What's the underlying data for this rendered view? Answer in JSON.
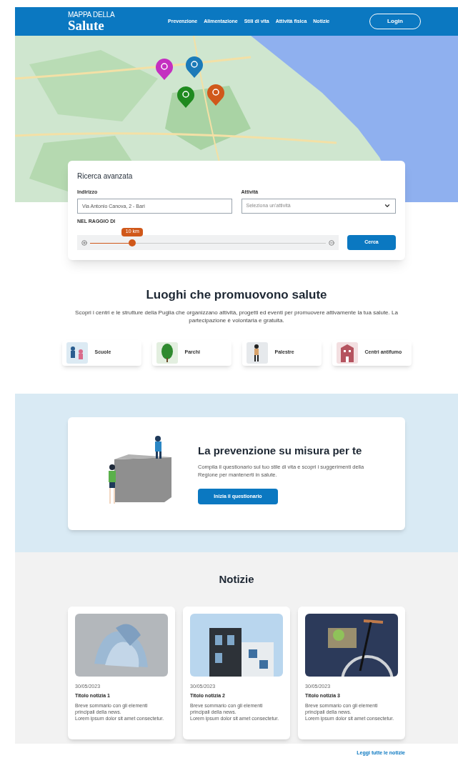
{
  "header": {
    "logo_top": "MAPPA DELLA",
    "logo_bottom": "Salute",
    "nav": [
      {
        "label": "Prevenzione"
      },
      {
        "label": "Alimentazione"
      },
      {
        "label": "Stili di vita"
      },
      {
        "label": "Attività fisica"
      },
      {
        "label": "Notizie"
      }
    ],
    "login": "Login"
  },
  "map": {
    "kind": "picture",
    "markers": [
      {
        "color": "#c42fc0"
      },
      {
        "color": "#1b7ab8"
      },
      {
        "color": "#1f8a1f"
      },
      {
        "color": "#d0581a"
      }
    ]
  },
  "search": {
    "title": "Ricerca avanzata",
    "address_label": "Indirizzo",
    "address_value": "Via Antonio Canova, 2 - Bari",
    "activity_label": "Attività",
    "activity_placeholder": "Seleziona un'attività",
    "radius_label": "NEL RAGGIO DI",
    "radius": {
      "reading": "10 km",
      "level": 0.18
    },
    "button": "Cerca"
  },
  "places": {
    "title": "Luoghi che promuovono salute",
    "text": "Scopri i centri e le strutture della Puglia che organizzano attività, progetti ed eventi per promuovere attivamente la tua salute. La partecipazione è volontaria e gratuita.",
    "items": [
      {
        "kind": "school",
        "label": "Scuole"
      },
      {
        "kind": "park",
        "label": "Parchi"
      },
      {
        "kind": "gym",
        "label": "Palestre"
      },
      {
        "kind": "building",
        "label": "Centri antifumo"
      }
    ]
  },
  "prevention": {
    "title": "La prevenzione su misura per te",
    "text": "Compila il questionario sul tuo stile di vita e scopri i suggerimenti della Regione per mantenerti in salute.",
    "button": "Inizia il questionario"
  },
  "news": {
    "title": "Notizie",
    "items": [
      {
        "kind": "fabric",
        "date": "30/05/2023",
        "title": "Titolo notizia 1",
        "summary": "Breve sommario con gli elementi principali della news.",
        "lorem": "Lorem ipsum dolor sit amet consectetur."
      },
      {
        "kind": "building",
        "date": "30/05/2023",
        "title": "Titolo notizia 2",
        "summary": "Breve sommario con gli elementi principali della news.",
        "lorem": "Lorem ipsum dolor sit amet consectetur."
      },
      {
        "kind": "bike",
        "date": "30/05/2023",
        "title": "Titolo notizia 3",
        "summary": "Breve sommario con gli elementi principali della news.",
        "lorem": "Lorem ipsum dolor sit amet consectetur."
      }
    ],
    "link": "Leggi tutte le notizie"
  }
}
